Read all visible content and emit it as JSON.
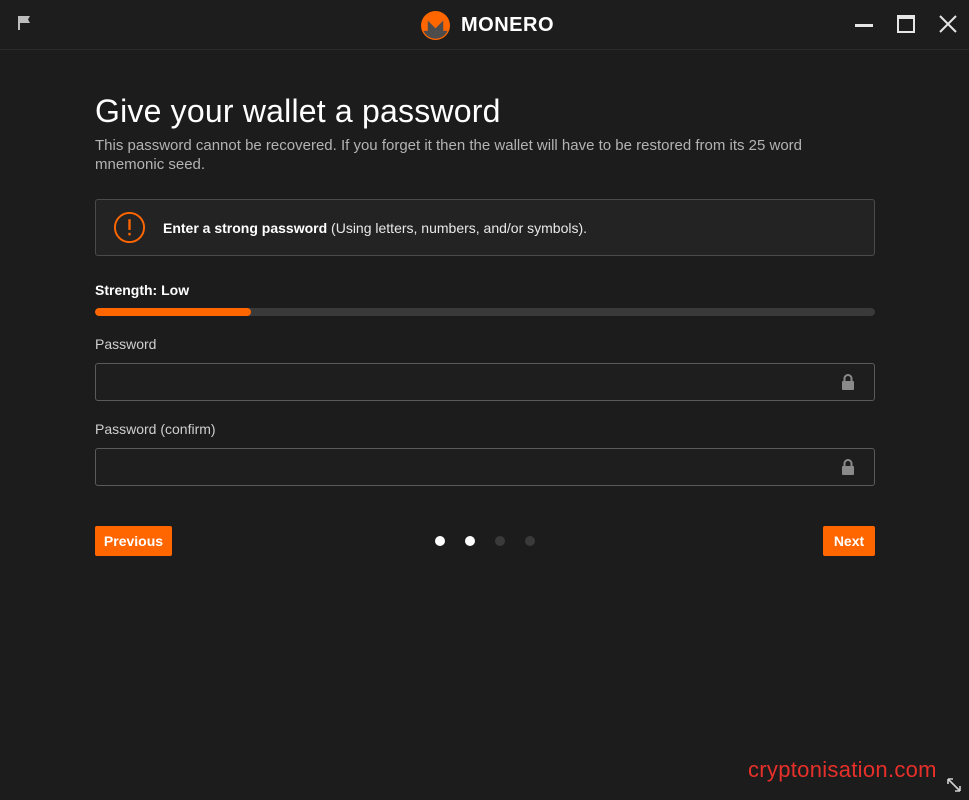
{
  "app": {
    "name": "MONERO"
  },
  "colors": {
    "accent": "#ff6600",
    "background": "#1c1c1c",
    "watermark": "#e8302a"
  },
  "header": {
    "title": "Give your wallet a password",
    "subtitle": "This password cannot be recovered. If you forget it then the wallet will have to be restored from its 25 word mnemonic seed."
  },
  "notice": {
    "icon": "warning-circle-icon",
    "bold": "Enter a strong password",
    "rest": " (Using letters, numbers, and/or symbols)."
  },
  "strength": {
    "label": "Strength: Low",
    "fraction": 0.2
  },
  "fields": {
    "password": {
      "label": "Password",
      "value": ""
    },
    "confirm": {
      "label": "Password (confirm)",
      "value": ""
    }
  },
  "nav": {
    "previous_label": "Previous",
    "next_label": "Next",
    "pages_total": 4,
    "pages_completed": 2
  },
  "watermark": "cryptonisation.com"
}
